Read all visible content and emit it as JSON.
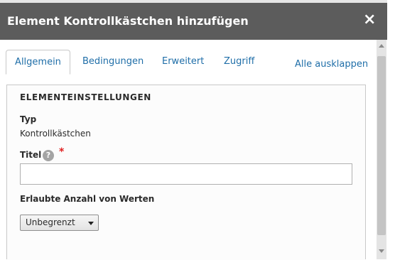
{
  "dialog": {
    "title": "Element Kontrollkästchen hinzufügen",
    "close_glyph": "×"
  },
  "tabs": [
    {
      "label": "Allgemein",
      "active": true
    },
    {
      "label": "Bedingungen",
      "active": false
    },
    {
      "label": "Erweitert",
      "active": false
    },
    {
      "label": "Zugriff",
      "active": false
    }
  ],
  "expand_all_label": "Alle ausklappen",
  "settings": {
    "section_title": "ELEMENTEINSTELLUNGEN",
    "type_label": "Typ",
    "type_value": "Kontrollkästchen",
    "title_label": "Titel",
    "help_glyph": "?",
    "required_marker": "*",
    "title_value": "",
    "allowed_values_label": "Erlaubte Anzahl von Werten",
    "allowed_values_selected": "Unbegrenzt"
  },
  "icons": {
    "close": "close-icon",
    "help": "help-icon",
    "dropdown": "chevron-down-icon"
  },
  "colors": {
    "titlebar": "#5c5c5c",
    "link": "#1f6ea8",
    "required": "#e02020"
  }
}
